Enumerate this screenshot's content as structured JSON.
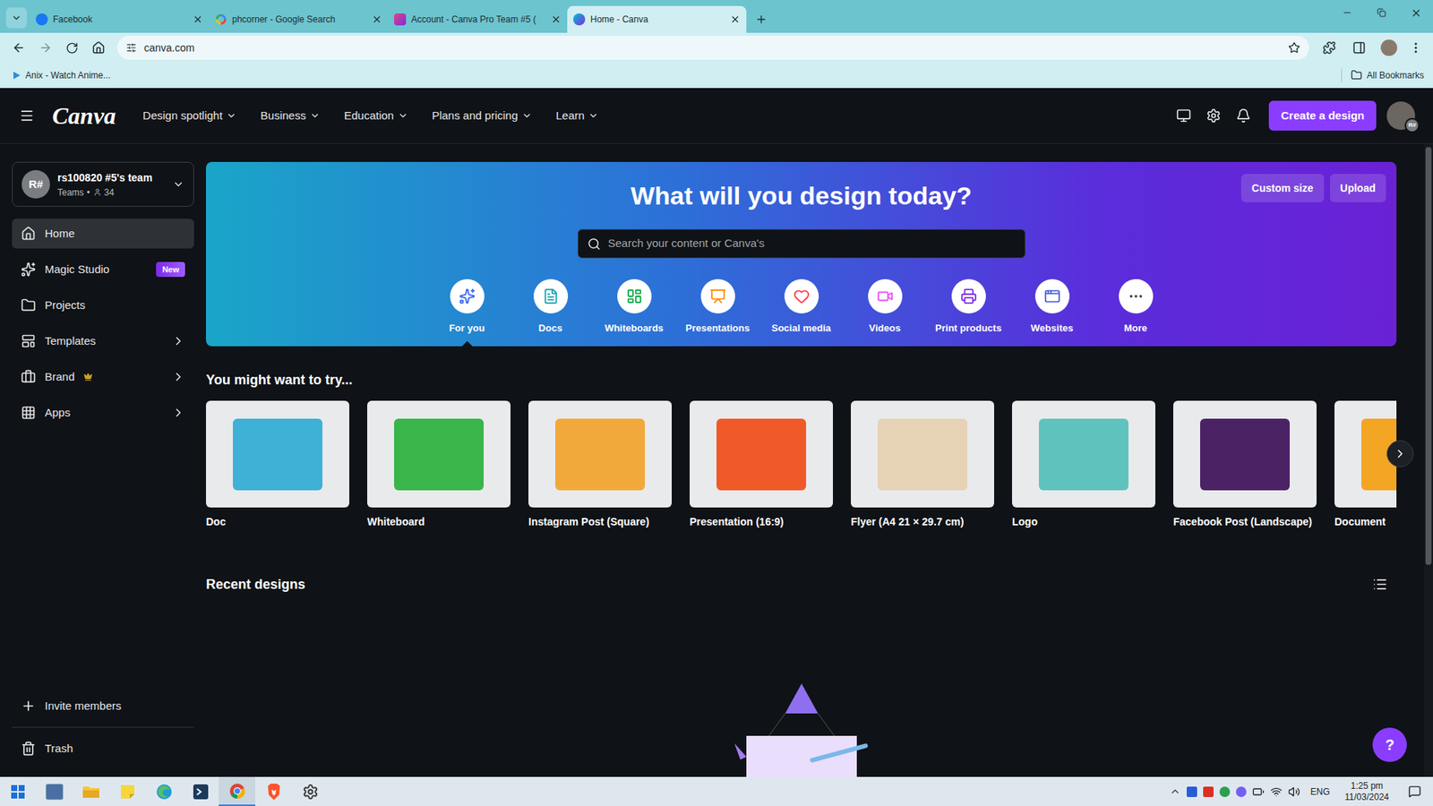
{
  "browser": {
    "tabs": [
      {
        "title": "Facebook",
        "kind": "facebook",
        "selected": false
      },
      {
        "title": "phcorner - Google Search",
        "kind": "google",
        "selected": false
      },
      {
        "title": "Account - Canva Pro Team #5 (",
        "kind": "canva-account",
        "selected": false
      },
      {
        "title": "Home - Canva",
        "kind": "canva",
        "selected": true
      }
    ],
    "address": "canva.com",
    "bookmarks": [
      {
        "title": "Anix - Watch Anime..."
      }
    ],
    "all_bookmarks": "All Bookmarks"
  },
  "header": {
    "logo": "Canva",
    "menu": [
      "Design spotlight",
      "Business",
      "Education",
      "Plans and pricing",
      "Learn"
    ],
    "create_button": "Create a design",
    "avatar_badge": "R#"
  },
  "team": {
    "avatar": "R#",
    "name": "rs100820 #5's team",
    "type": "Teams",
    "separator": "•",
    "members": "34"
  },
  "sidebar": {
    "items": [
      {
        "label": "Home",
        "selected": true,
        "chevron": false,
        "premium": false
      },
      {
        "label": "Magic Studio",
        "selected": false,
        "chevron": false,
        "premium": false,
        "badge": "New"
      },
      {
        "label": "Projects",
        "selected": false,
        "chevron": false,
        "premium": false
      },
      {
        "label": "Templates",
        "selected": false,
        "chevron": true,
        "premium": false
      },
      {
        "label": "Brand",
        "selected": false,
        "chevron": true,
        "premium": true
      },
      {
        "label": "Apps",
        "selected": false,
        "chevron": true,
        "premium": false
      }
    ],
    "footer": [
      "Invite members",
      "Trash"
    ]
  },
  "hero": {
    "title": "What will you design today?",
    "buttons": [
      "Custom size",
      "Upload"
    ],
    "search_placeholder": "Search your content or Canva's",
    "categories": [
      {
        "label": "For you",
        "selected": true,
        "color": "#3164f4"
      },
      {
        "label": "Docs",
        "selected": false,
        "color": "#13a3b5"
      },
      {
        "label": "Whiteboards",
        "selected": false,
        "color": "#0ba84a"
      },
      {
        "label": "Presentations",
        "selected": false,
        "color": "#ff8b00"
      },
      {
        "label": "Social media",
        "selected": false,
        "color": "#ff3b4b"
      },
      {
        "label": "Videos",
        "selected": false,
        "color": "#e950f7"
      },
      {
        "label": "Print products",
        "selected": false,
        "color": "#7d2ae8"
      },
      {
        "label": "Websites",
        "selected": false,
        "color": "#4b5fe0"
      },
      {
        "label": "More",
        "selected": false,
        "color": "#3a3d42"
      }
    ]
  },
  "suggestions": {
    "title": "You might want to try...",
    "items": [
      {
        "label": "Doc",
        "color": "#3fb0d6"
      },
      {
        "label": "Whiteboard",
        "color": "#39b54a"
      },
      {
        "label": "Instagram Post (Square)",
        "color": "#f2a93b"
      },
      {
        "label": "Presentation (16:9)",
        "color": "#f05a28"
      },
      {
        "label": "Flyer (A4 21 × 29.7 cm)",
        "color": "#e6d2b5"
      },
      {
        "label": "Logo",
        "color": "#5fc3bd"
      },
      {
        "label": "Facebook Post (Landscape)",
        "color": "#4b2264"
      },
      {
        "label": "Document",
        "color": "#f3a524"
      }
    ]
  },
  "recent": {
    "title": "Recent designs"
  },
  "help": "?",
  "taskbar": {
    "language": "ENG",
    "time": "1:25 pm",
    "date": "11/03/2024"
  }
}
